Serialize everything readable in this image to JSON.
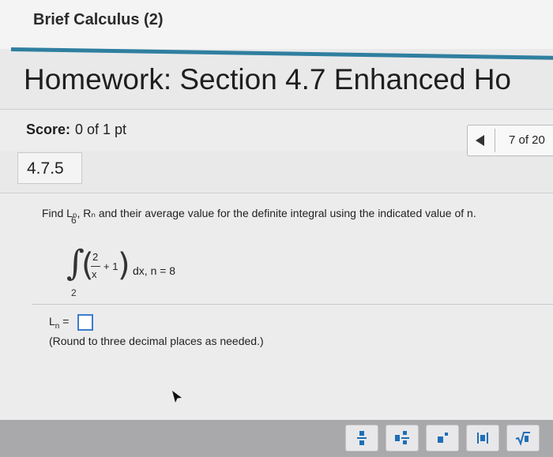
{
  "course": {
    "title": "Brief Calculus (2)"
  },
  "homework": {
    "title": "Homework: Section 4.7 Enhanced Ho"
  },
  "score": {
    "label": "Score:",
    "value": "0 of 1 pt"
  },
  "pager": {
    "text": "7 of 20"
  },
  "section": {
    "number": "4.7.5"
  },
  "question": {
    "prompt": "Find Lₙ, Rₙ and their average value for the definite integral using the indicated value of n.",
    "integral": {
      "upper": "6",
      "lower": "2",
      "numerator": "2",
      "denominator": "x",
      "plus": "+ 1",
      "dx_n": "dx, n = 8"
    },
    "answer_label": "L",
    "answer_sub": "n",
    "answer_eq": " =",
    "answer_value": "",
    "note": "(Round to three decimal places as needed.)"
  },
  "toolbar": {
    "buttons": [
      "fraction-icon",
      "mixed-number-icon",
      "exponent-icon",
      "absolute-value-icon",
      "square-root-icon"
    ]
  },
  "colors": {
    "accent": "#2f7fa0",
    "toolbar_icon": "#1e6fb8",
    "answer_border": "#3b7ccf"
  }
}
